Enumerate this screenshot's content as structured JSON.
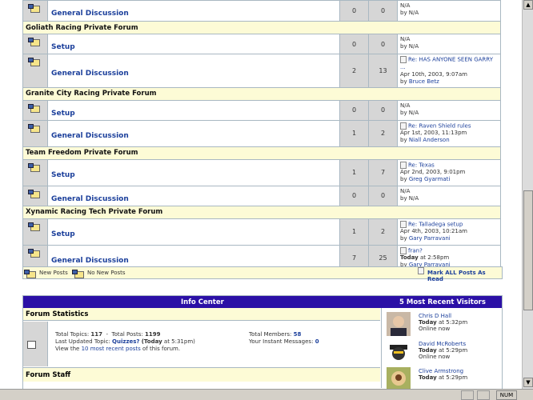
{
  "window": {
    "status_num": "NUM"
  },
  "forums": {
    "top_row": {
      "name": "General Discussion",
      "topics": "0",
      "posts": "0",
      "last_line1": "N/A",
      "last_line2": "by N/A"
    },
    "categories": [
      {
        "title": "Goliath Racing Private Forum",
        "rows": [
          {
            "name": "Setup",
            "topics": "0",
            "posts": "0",
            "last_line1": "N/A",
            "last_line2": "by N/A"
          },
          {
            "name": "General Discussion",
            "topics": "2",
            "posts": "13",
            "last_title": "Re: HAS ANYONE SEEN GARRY ...",
            "last_date": "Apr 10th, 2003, 9:07am",
            "last_by_prefix": "by",
            "last_by": "Bruce Betz"
          }
        ]
      },
      {
        "title": "Granite City Racing Private Forum",
        "rows": [
          {
            "name": "Setup",
            "topics": "0",
            "posts": "0",
            "last_line1": "N/A",
            "last_line2": "by N/A"
          },
          {
            "name": "General Discussion",
            "topics": "1",
            "posts": "2",
            "last_title": "Re: Raven Shield rules",
            "last_date": "Apr 1st, 2003, 11:13pm",
            "last_by_prefix": "by",
            "last_by": "Niall Anderson"
          }
        ]
      },
      {
        "title": "Team Freedom Private Forum",
        "rows": [
          {
            "name": "Setup",
            "topics": "1",
            "posts": "7",
            "last_title": "Re: Texas",
            "last_date": "Apr 2nd, 2003, 9:01pm",
            "last_by_prefix": "by",
            "last_by": "Greg Gyarmati"
          },
          {
            "name": "General Discussion",
            "topics": "0",
            "posts": "0",
            "last_line1": "N/A",
            "last_line2": "by N/A"
          }
        ]
      },
      {
        "title": "Xynamic Racing Tech Private Forum",
        "rows": [
          {
            "name": "Setup",
            "topics": "1",
            "posts": "2",
            "last_title": "Re: Talladega setup",
            "last_date": "Apr 4th, 2003, 10:21am",
            "last_by_prefix": "by",
            "last_by": "Gary Parravani"
          },
          {
            "name": "General Discussion",
            "topics": "7",
            "posts": "25",
            "last_title": "fran?",
            "last_date_bold": "Today",
            "last_date": "at 2:58pm",
            "last_by_prefix": "by",
            "last_by": "Gary Parravani"
          }
        ]
      }
    ]
  },
  "legend": {
    "new_posts": "New Posts",
    "no_new_posts": "No New Posts",
    "mark_all": "Mark ALL Posts As Read"
  },
  "info_center": {
    "title": "Info Center",
    "visitors_title": "5 Most Recent Visitors",
    "stats_title": "Forum Statistics",
    "total_topics_label": "Total Topics:",
    "total_topics": "117",
    "dash": "-",
    "total_posts_label": "Total Posts:",
    "total_posts": "1199",
    "total_members_label": "Total Members:",
    "total_members": "58",
    "last_updated_label": "Last Updated Topic:",
    "last_updated_topic": "Quizzes?",
    "last_updated_today": "(Today",
    "last_updated_time": "at 5:31pm)",
    "instant_label": "Your Instant Messages:",
    "instant_count": "0",
    "view_prefix": "View the",
    "view_link": "10 most recent posts",
    "view_suffix": "of this forum.",
    "staff_title": "Forum Staff",
    "visitors": [
      {
        "name": "Chris D Hall",
        "today": "Today",
        "time": "at 5:32pm",
        "status": "Online now"
      },
      {
        "name": "David McRoberts",
        "today": "Today",
        "time": "at 5:29pm",
        "status": "Online now"
      },
      {
        "name": "Clive Armstrong",
        "today": "Today",
        "time": "at 5:29pm",
        "status": ""
      }
    ]
  }
}
